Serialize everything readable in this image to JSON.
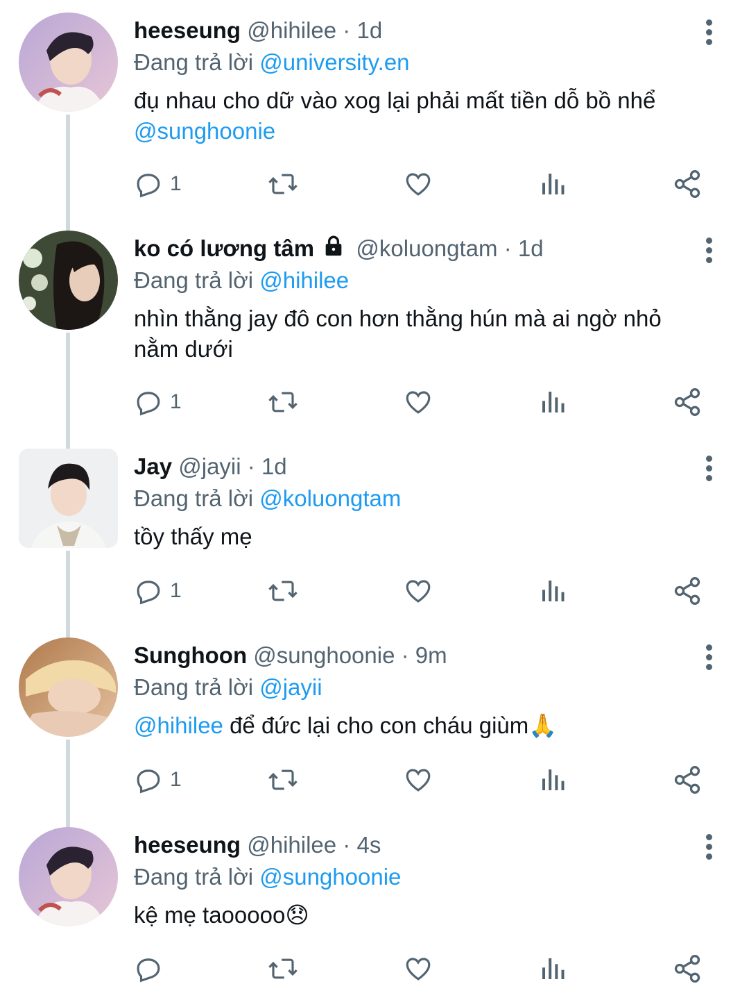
{
  "reply_prefix": "Đang trả lời",
  "tweets": [
    {
      "name": "heeseung",
      "handle": "@hihilee",
      "time": "1d",
      "reply_to": "@university.en",
      "body_segments": [
        {
          "text": "đụ nhau cho dữ vào xog lại phải mất tiền dỗ bồ nhể ",
          "mention": false
        },
        {
          "text": "@sunghoonie",
          "mention": true
        }
      ],
      "reply_count": "1"
    },
    {
      "name": "ko có lương tâm",
      "locked": true,
      "handle": "@koluongtam",
      "time": "1d",
      "reply_to": "@hihilee",
      "body_segments": [
        {
          "text": "nhìn thằng jay đô con hơn thằng hún mà ai ngờ nhỏ nằm dưới",
          "mention": false
        }
      ],
      "reply_count": "1"
    },
    {
      "name": "Jay",
      "handle": "@jayii",
      "time": "1d",
      "reply_to": "@koluongtam",
      "body_segments": [
        {
          "text": "tồy thấy mẹ",
          "mention": false
        }
      ],
      "reply_count": "1"
    },
    {
      "name": "Sunghoon",
      "handle": "@sunghoonie",
      "time": "9m",
      "reply_to": "@jayii",
      "body_segments": [
        {
          "text": "@hihilee",
          "mention": true
        },
        {
          "text": " để đức lại cho con cháu giùm🙏",
          "mention": false
        }
      ],
      "reply_count": "1"
    },
    {
      "name": "heeseung",
      "handle": "@hihilee",
      "time": "4s",
      "reply_to": "@sunghoonie",
      "body_segments": [
        {
          "text": "kệ mẹ taooooo😞",
          "mention": false
        }
      ],
      "reply_count": ""
    }
  ],
  "colors": {
    "accent": "#1d9bf0",
    "secondary_text": "#536471",
    "thread_line": "#cfd9de"
  },
  "icons": [
    "reply-icon",
    "retweet-icon",
    "like-icon",
    "views-icon",
    "share-icon",
    "more-options-icon",
    "lock-icon"
  ]
}
